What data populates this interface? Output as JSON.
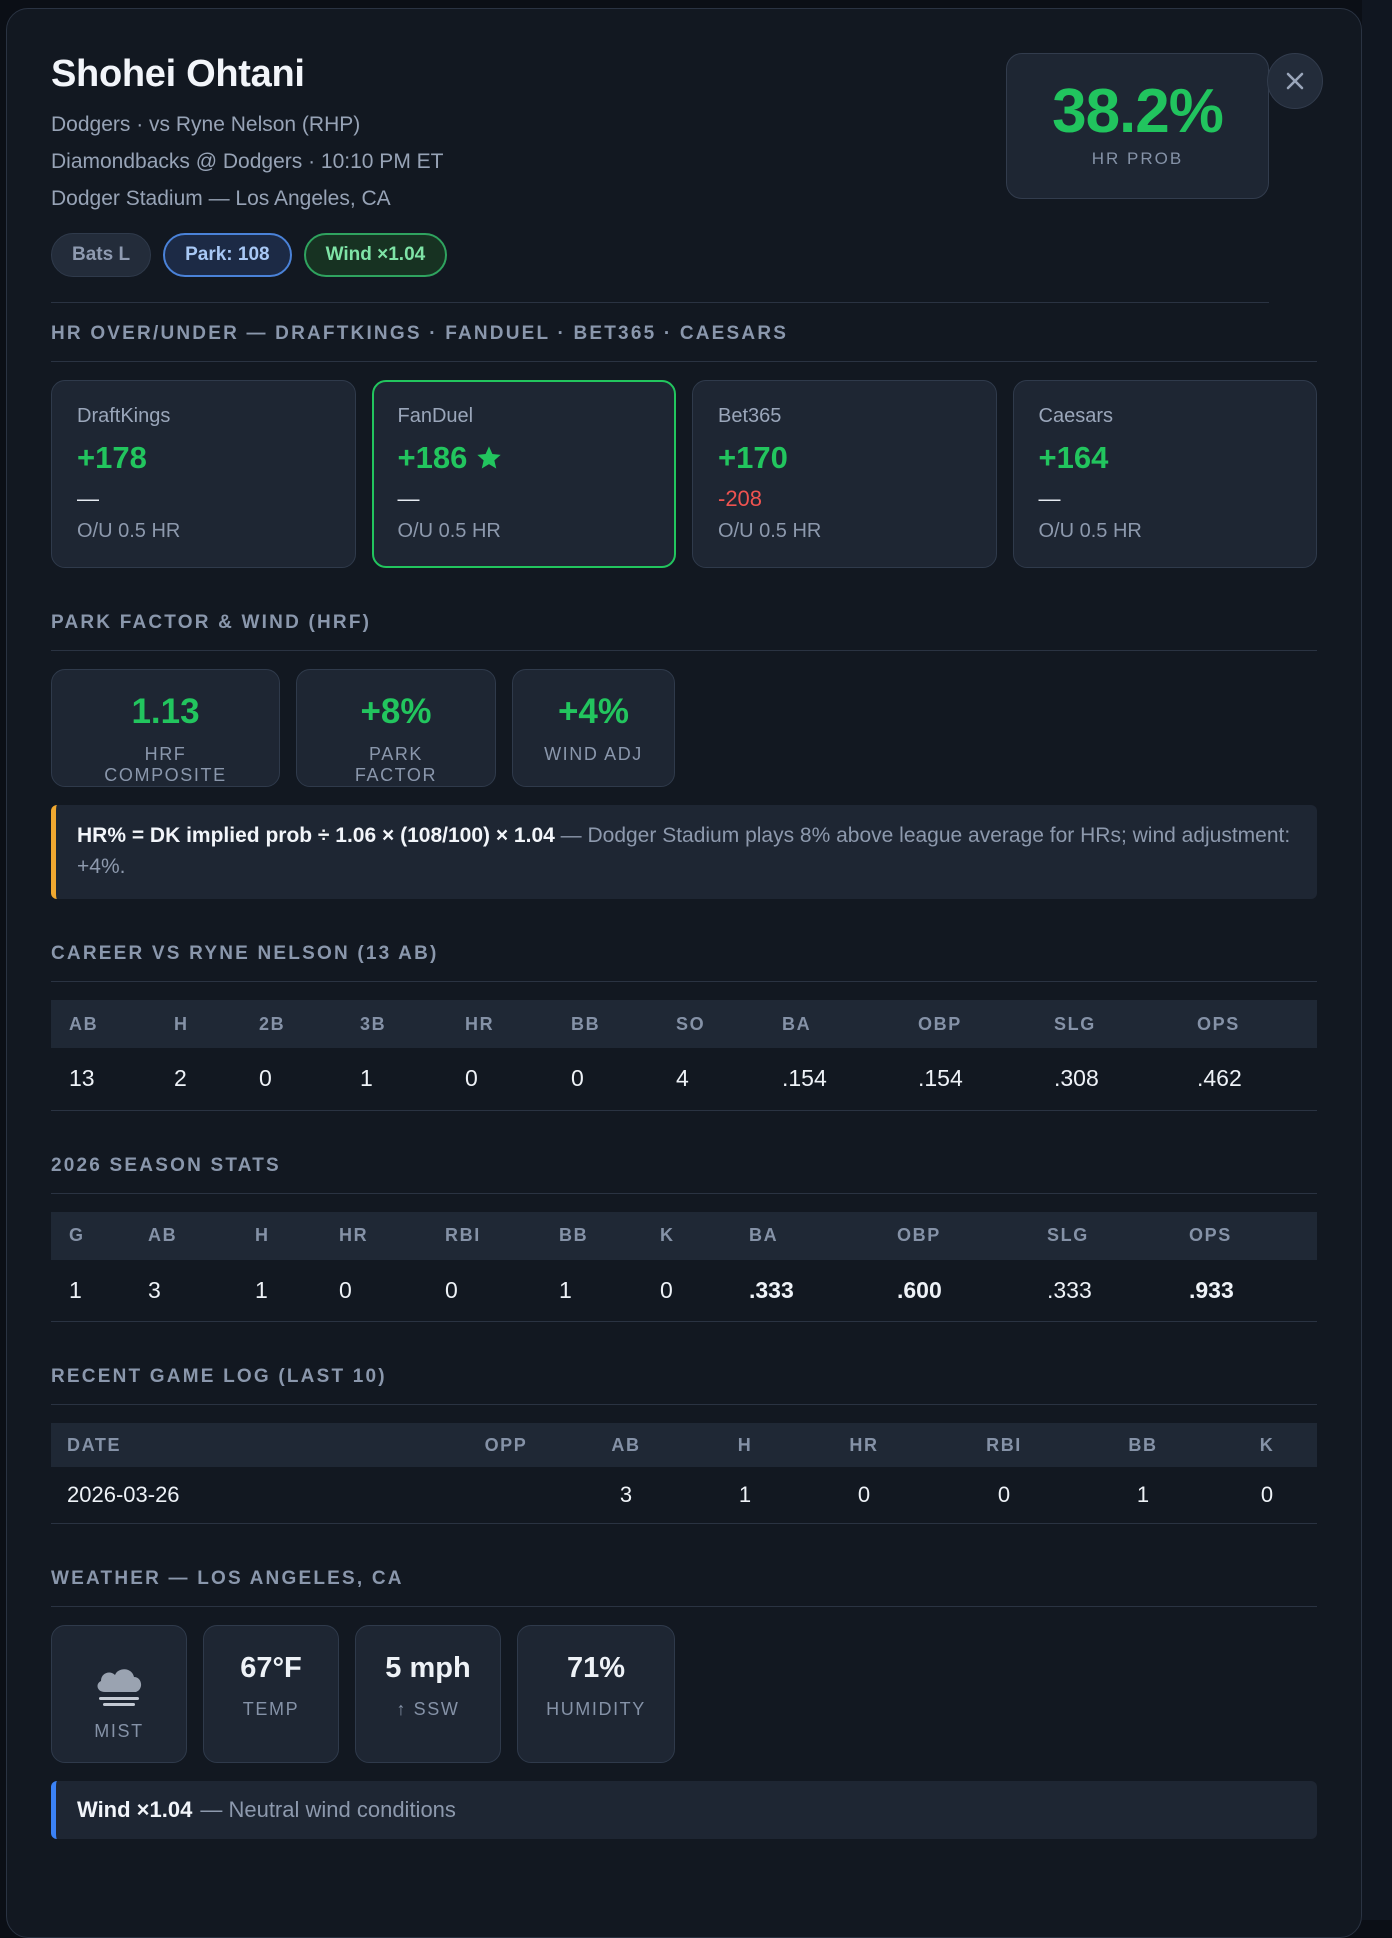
{
  "player": {
    "name": "Shohei Ohtani",
    "matchup": "Dodgers · vs Ryne Nelson (RHP)",
    "game": "Diamondbacks @ Dodgers · 10:10 PM ET",
    "venue": "Dodger Stadium — Los Angeles, CA",
    "chips": {
      "bats": "Bats L",
      "park": "Park: 108",
      "wind": "Wind ×1.04"
    }
  },
  "hr_prob": {
    "value": "38.2%",
    "label": "HR PROB"
  },
  "close_icon": "close-icon",
  "odds": {
    "title": "HR OVER/UNDER — DRAFTKINGS · FANDUEL · BET365 · CAESARS",
    "books": [
      {
        "name": "DraftKings",
        "over": "+178",
        "under": "—",
        "line": "O/U 0.5 HR",
        "best": false
      },
      {
        "name": "FanDuel",
        "over": "+186",
        "under": "—",
        "line": "O/U 0.5 HR",
        "best": true,
        "icon": "star-icon"
      },
      {
        "name": "Bet365",
        "over": "+170",
        "under": "-208",
        "line": "O/U 0.5 HR",
        "best": false
      },
      {
        "name": "Caesars",
        "over": "+164",
        "under": "—",
        "line": "O/U 0.5 HR",
        "best": false
      }
    ]
  },
  "park": {
    "title": "PARK FACTOR & WIND (HRF)",
    "cards": [
      {
        "value": "1.13",
        "label": "HRF COMPOSITE"
      },
      {
        "value": "+8%",
        "label": "PARK FACTOR"
      },
      {
        "value": "+4%",
        "label": "WIND ADJ"
      }
    ],
    "formula_bold": "HR% = DK implied prob ÷ 1.06 × (108/100) × 1.04",
    "formula_text": " — Dodger Stadium plays 8% above league average for HRs; wind adjustment: +4%."
  },
  "career": {
    "title": "CAREER VS RYNE NELSON (13 AB)",
    "headers": [
      "AB",
      "H",
      "2B",
      "3B",
      "HR",
      "BB",
      "SO",
      "BA",
      "OBP",
      "SLG",
      "OPS"
    ],
    "row": [
      "13",
      "2",
      "0",
      "1",
      "0",
      "0",
      "4",
      ".154",
      ".154",
      ".308",
      ".462"
    ]
  },
  "season": {
    "title": "2026 SEASON STATS",
    "headers": [
      "G",
      "AB",
      "H",
      "HR",
      "RBI",
      "BB",
      "K",
      "BA",
      "OBP",
      "SLG",
      "OPS"
    ],
    "row": [
      "1",
      "3",
      "1",
      "0",
      "0",
      "1",
      "0",
      ".333",
      ".600",
      ".333",
      ".933"
    ]
  },
  "gamelog": {
    "title": "RECENT GAME LOG (LAST 10)",
    "headers": [
      "DATE",
      "OPP",
      "AB",
      "H",
      "HR",
      "RBI",
      "BB",
      "K"
    ],
    "rows": [
      [
        "2026-03-26",
        "",
        "3",
        "1",
        "0",
        "0",
        "1",
        "0"
      ]
    ]
  },
  "weather": {
    "title": "WEATHER — LOS ANGELES, CA",
    "condition": {
      "icon": "cloud-icon",
      "label": "MIST"
    },
    "temp": {
      "value": "67°F",
      "label": "TEMP"
    },
    "wind": {
      "value": "5 mph",
      "label": "↑ SSW"
    },
    "humidity": {
      "value": "71%",
      "label": "HUMIDITY"
    },
    "note_bold": "Wind ×1.04",
    "note_text": "— Neutral wind conditions"
  },
  "colors": {
    "positive": "#22c55e",
    "negative": "#ef5350",
    "accent_warning": "#f0a830",
    "accent_info": "#3b82f6"
  }
}
